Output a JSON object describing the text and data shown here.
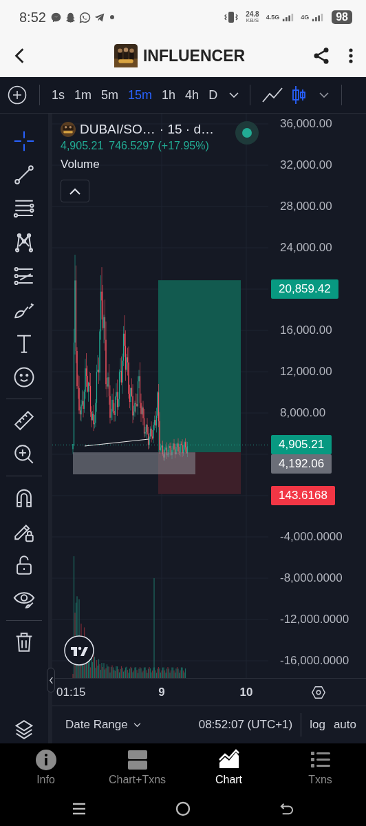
{
  "status_bar": {
    "time": "8:52",
    "net_speed": "24.8",
    "net_unit": "KB/S",
    "network_1": "4.5G",
    "network_2": "4G",
    "battery": "98"
  },
  "header": {
    "title": "INFLUENCER"
  },
  "toolbar": {
    "intervals": [
      {
        "label": "1s",
        "selected": false
      },
      {
        "label": "1m",
        "selected": false
      },
      {
        "label": "5m",
        "selected": false
      },
      {
        "label": "15m",
        "selected": true
      },
      {
        "label": "1h",
        "selected": false
      },
      {
        "label": "4h",
        "selected": false
      },
      {
        "label": "D",
        "selected": false
      }
    ],
    "chart_styles": [
      {
        "kind": "line",
        "selected": false
      },
      {
        "kind": "candles",
        "selected": true
      }
    ]
  },
  "drawing_tools": [
    [
      {
        "kind": "crosshair",
        "selected": true
      },
      {
        "kind": "trend-line",
        "selected": false
      },
      {
        "kind": "fib",
        "selected": false
      },
      {
        "kind": "pattern",
        "selected": false
      },
      {
        "kind": "forecast",
        "selected": false
      },
      {
        "kind": "brush",
        "selected": false
      },
      {
        "kind": "text",
        "selected": false
      },
      {
        "kind": "emoji",
        "selected": false
      }
    ],
    [
      {
        "kind": "ruler",
        "selected": false
      },
      {
        "kind": "zoom",
        "selected": false
      }
    ],
    [
      {
        "kind": "magnet",
        "selected": false
      },
      {
        "kind": "lock-drawings",
        "selected": false
      },
      {
        "kind": "lock",
        "selected": false
      },
      {
        "kind": "eye",
        "selected": false
      }
    ],
    [
      {
        "kind": "trash",
        "selected": false
      }
    ]
  ],
  "legend": {
    "symbol": "DUBAI/SO…",
    "interval": "· 15 · d…",
    "price": "4,905.21",
    "change": "746.5297 (+17.95%)",
    "indicator": "Volume"
  },
  "price_axis": [
    {
      "kind": "tick",
      "label": "36,000.00"
    },
    {
      "kind": "tick",
      "label": "32,000.00"
    },
    {
      "kind": "tick",
      "label": "28,000.00"
    },
    {
      "kind": "tick",
      "label": "24,000.00"
    },
    {
      "kind": "badges",
      "badges": [
        {
          "kind": "profit",
          "text": "20,859.42"
        }
      ]
    },
    {
      "kind": "tick",
      "label": "16,000.00"
    },
    {
      "kind": "tick",
      "label": "12,000.00"
    },
    {
      "kind": "tick",
      "label": "8,000.00"
    },
    {
      "kind": "badges",
      "badges": [
        {
          "kind": "last",
          "text": "4,905.21"
        },
        {
          "kind": "entry",
          "text": "4,192.06"
        }
      ]
    },
    {
      "kind": "badges",
      "badges": [
        {
          "kind": "stop",
          "text": "143.6168"
        }
      ]
    },
    {
      "kind": "tick",
      "label": "-4,000.0000"
    },
    {
      "kind": "tick",
      "label": "-8,000.0000"
    },
    {
      "kind": "tick",
      "label": "-12,000.0000"
    },
    {
      "kind": "tick",
      "label": "-16,000.0000"
    }
  ],
  "time_axis": [
    {
      "label": "01:15",
      "bold": false
    },
    {
      "label": "9",
      "bold": true
    },
    {
      "label": "10",
      "bold": true
    }
  ],
  "footer": {
    "date_range": "Date Range",
    "clock": "08:52:07 (UTC+1)",
    "scale_options": [
      "log",
      "auto"
    ]
  },
  "bottom_nav": [
    {
      "kind": "info",
      "label": "Info",
      "selected": false
    },
    {
      "kind": "split",
      "label": "Chart+Txns",
      "selected": false
    },
    {
      "kind": "chart",
      "label": "Chart",
      "selected": true
    },
    {
      "kind": "list",
      "label": "Txns",
      "selected": false
    }
  ]
}
